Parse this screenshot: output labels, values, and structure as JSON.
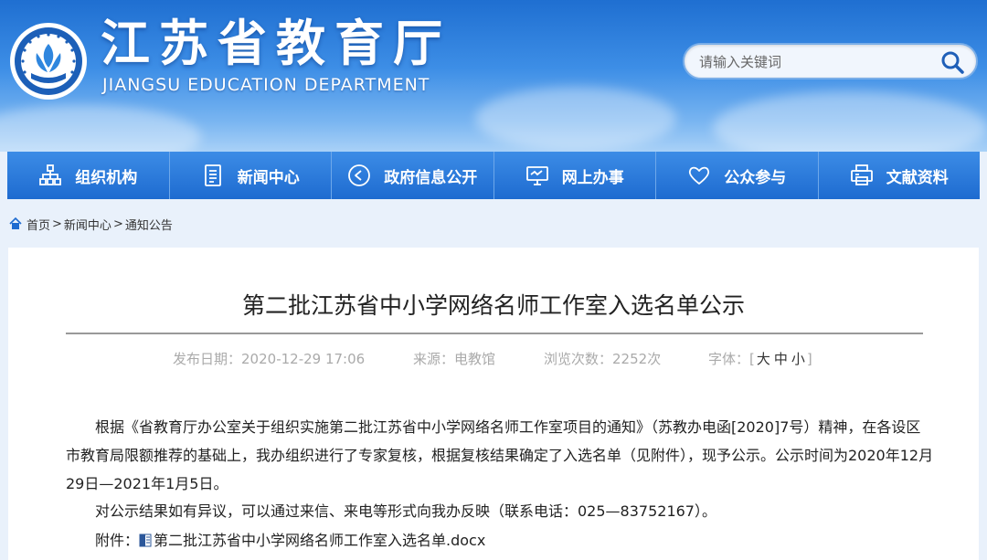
{
  "header": {
    "title": "江苏省教育厅",
    "subtitle": "JIANGSU EDUCATION DEPARTMENT",
    "search_placeholder": "请输入关键词"
  },
  "nav": {
    "items": [
      {
        "label": "组织机构",
        "icon": "org-chart-icon"
      },
      {
        "label": "新闻中心",
        "icon": "document-icon"
      },
      {
        "label": "政府信息公开",
        "icon": "play-circle-icon"
      },
      {
        "label": "网上办事",
        "icon": "monitor-icon"
      },
      {
        "label": "公众参与",
        "icon": "heart-icon"
      },
      {
        "label": "文献资料",
        "icon": "printer-icon"
      }
    ]
  },
  "breadcrumb": {
    "items": [
      "首页",
      "新闻中心",
      "通知公告"
    ],
    "separator": ">"
  },
  "article": {
    "title": "第二批江苏省中小学网络名师工作室入选名单公示",
    "meta": {
      "date_label": "发布日期：",
      "date": "2020-12-29 17:06",
      "source_label": "来源：",
      "source": "电教馆",
      "views_label": "浏览次数：",
      "views": "2252次",
      "font_label": "字体：",
      "font_open": "[",
      "font_large": "大",
      "font_medium": "中",
      "font_small": "小",
      "font_close": "]"
    },
    "paragraph1": "根据《省教育厅办公室关于组织实施第二批江苏省中小学网络名师工作室项目的通知》（苏教办电函[2020]7号）精神，在各设区市教育局限额推荐的基础上，我办组织进行了专家复核，根据复核结果确定了入选名单（见附件），现予公示。公示时间为2020年12月29日—2021年1月5日。",
    "paragraph2": "对公示结果如有异议，可以通过来信、来电等形式向我办反映（联系电话：025—83752167）。",
    "attachment_label": "附件：",
    "attachment_name": "第二批江苏省中小学网络名师工作室入选名单.docx"
  },
  "colors": {
    "nav_bg": "#2a7bdc",
    "header_top": "#1f6fd1",
    "page_bg": "#e9f1fb"
  }
}
